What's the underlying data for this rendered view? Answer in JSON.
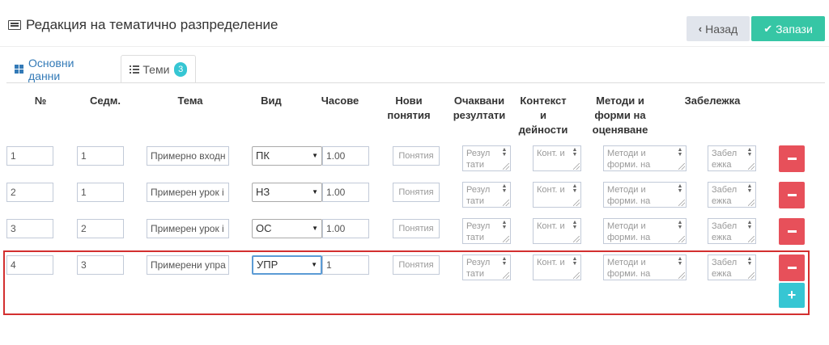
{
  "header": {
    "title": "Редакция на тематично разпределение",
    "back_label": "Назад",
    "save_label": "Запази"
  },
  "tabs": [
    {
      "label": "Основни данни"
    },
    {
      "label": "Теми",
      "badge": "3"
    }
  ],
  "columns": {
    "num": "№",
    "week": "Седм.",
    "topic": "Тема",
    "type": "Вид",
    "hours": "Часове",
    "new_concepts": [
      "Нови",
      "понятия"
    ],
    "expected_results": [
      "Очаквани",
      "резултати"
    ],
    "context": [
      "Контекст",
      "и",
      "дейности"
    ],
    "methods": [
      "Методи и",
      "форми на",
      "оценяване"
    ],
    "note": "Забележка"
  },
  "placeholders": {
    "new_concepts": "Понятия",
    "expected_results": "Резул тати",
    "context": "Конт. и",
    "methods": "Методи и форми. на",
    "note": "Забел ежка"
  },
  "rows": [
    {
      "num": "1",
      "week": "1",
      "topic": "Примерно входн",
      "type": "ПК",
      "hours": "1.00"
    },
    {
      "num": "2",
      "week": "1",
      "topic": "Примерен урок і",
      "type": "НЗ",
      "hours": "1.00"
    },
    {
      "num": "3",
      "week": "2",
      "topic": "Примерен урок і",
      "type": "ОС",
      "hours": "1.00"
    },
    {
      "num": "4",
      "week": "3",
      "topic": "Примерени упра",
      "type": "УПР",
      "hours": "1"
    }
  ],
  "colors": {
    "accent": "#36c6a5",
    "danger": "#e7505a",
    "info": "#36c6d3",
    "highlight": "#d32f2f",
    "link": "#337ab7"
  },
  "icons": {
    "title": "list-alt-icon",
    "back": "chevron-left-icon",
    "save": "check-icon",
    "tab_basic": "grid-icon",
    "tab_topics": "list-icon",
    "delete": "minus-icon",
    "add": "plus-icon"
  }
}
